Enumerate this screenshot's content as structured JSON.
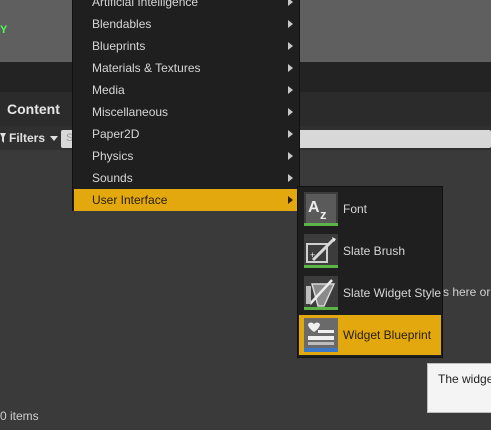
{
  "menu": {
    "items": [
      {
        "label": "Artificial Intelligence"
      },
      {
        "label": "Blendables"
      },
      {
        "label": "Blueprints"
      },
      {
        "label": "Materials & Textures"
      },
      {
        "label": "Media"
      },
      {
        "label": "Miscellaneous"
      },
      {
        "label": "Paper2D"
      },
      {
        "label": "Physics"
      },
      {
        "label": "Sounds"
      },
      {
        "label": "User Interface"
      }
    ]
  },
  "submenu": {
    "items": [
      {
        "label": "Font",
        "icon": "font-icon"
      },
      {
        "label": "Slate Brush",
        "icon": "slate-brush-icon"
      },
      {
        "label": "Slate Widget Style",
        "icon": "slate-widget-style-icon"
      },
      {
        "label": "Widget Blueprint",
        "icon": "widget-blueprint-icon"
      }
    ]
  },
  "panel": {
    "title": "Content",
    "filters_label": "Filters",
    "search_placeholder": "S",
    "assets_hint": "s here or",
    "items_count": "0 items",
    "tooltip": "The widge"
  },
  "viewport": {
    "axis_label": "Y"
  },
  "colors": {
    "accent": "#e3a80e",
    "menu_bg": "#1f1f1f"
  }
}
